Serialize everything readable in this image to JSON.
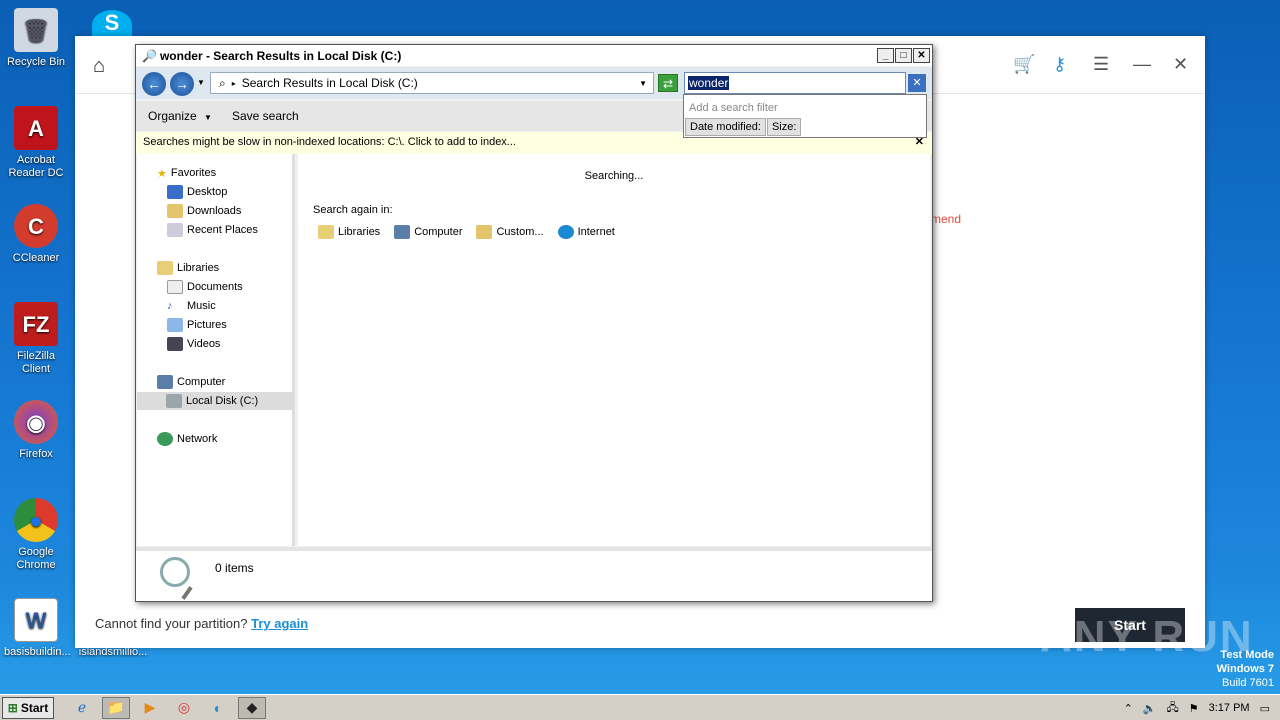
{
  "desktop": {
    "icons": [
      {
        "label": "Recycle Bin",
        "color": "#cfd8e3",
        "glyph": "🗑"
      },
      {
        "label": "Acrobat Reader DC",
        "color": "#c0141c",
        "glyph": "A"
      },
      {
        "label": "CCleaner",
        "color": "#d33b2c",
        "glyph": "C"
      },
      {
        "label": "FileZilla Client",
        "color": "#bf1d1d",
        "glyph": "FZ"
      },
      {
        "label": "Firefox",
        "color": "#e8602a",
        "glyph": "◉"
      },
      {
        "label": "Google Chrome",
        "color": "#2c8d3a",
        "glyph": "◎"
      },
      {
        "label": "basisbuildin...",
        "color": "#ffffff",
        "glyph": "W"
      }
    ],
    "file2_label": "islandsmillio..."
  },
  "bg_app": {
    "red_text": "mend",
    "footer_text": "Cannot find your partition?",
    "footer_link": "Try again",
    "start_button": "Start"
  },
  "explorer": {
    "title": "wonder - Search Results in Local Disk (C:)",
    "address": "Search Results in Local Disk (C:)",
    "search_value": "wonder",
    "filter_hint": "Add a search filter",
    "filter_chips": [
      "Date modified:",
      "Size:"
    ],
    "toolbar": {
      "organize": "Organize",
      "save_search": "Save search"
    },
    "infobar": "Searches might be slow in non-indexed locations: C:\\. Click to add to index...",
    "nav": {
      "favorites": "Favorites",
      "desktop": "Desktop",
      "downloads": "Downloads",
      "recent": "Recent Places",
      "libraries": "Libraries",
      "documents": "Documents",
      "music": "Music",
      "pictures": "Pictures",
      "videos": "Videos",
      "computer": "Computer",
      "local_disk": "Local Disk (C:)",
      "network": "Network"
    },
    "content": {
      "status": "Searching...",
      "search_again": "Search again in:",
      "locations": [
        "Libraries",
        "Computer",
        "Custom...",
        "Internet"
      ]
    },
    "details": {
      "count": "0 items"
    }
  },
  "taskbar": {
    "start": "Start",
    "time": "3:17 PM"
  },
  "overlay": {
    "watermark": "ANY RUN",
    "test_mode": "Test Mode",
    "os": "Windows 7",
    "build": "Build 7601"
  }
}
